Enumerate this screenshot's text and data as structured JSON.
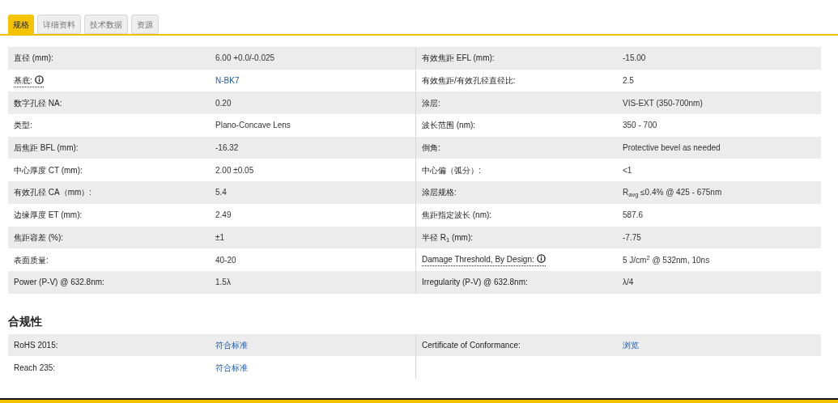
{
  "tabs": [
    {
      "label": "规格",
      "selected": true
    },
    {
      "label": "详细资料",
      "selected": false
    },
    {
      "label": "技术数据",
      "selected": false
    },
    {
      "label": "资源",
      "selected": false
    }
  ],
  "specs": {
    "rows": [
      [
        {
          "label": "直径 (mm):",
          "value": "6.00 +0.0/-0.025"
        },
        {
          "label": "有效焦距 EFL (mm):",
          "value": "-15.00"
        }
      ],
      [
        {
          "label": "基底:",
          "info": true,
          "value": "N-BK7",
          "link": true
        },
        {
          "label": "有效焦距/有效孔径直径比:",
          "value": "2.5"
        }
      ],
      [
        {
          "label": "数字孔径 NA:",
          "value": "0.20"
        },
        {
          "label": "涂层:",
          "value": "VIS-EXT (350-700nm)"
        }
      ],
      [
        {
          "label": "类型:",
          "value": "Plano-Concave Lens"
        },
        {
          "label": "波长范围 (nm):",
          "value": "350 - 700"
        }
      ],
      [
        {
          "label": "后焦距 BFL (mm):",
          "value": "-16.32"
        },
        {
          "label": "倒角:",
          "value": "Protective bevel as needed"
        }
      ],
      [
        {
          "label": "中心厚度 CT (mm):",
          "value": "2.00 ±0.05"
        },
        {
          "label": "中心偏（弧分）:",
          "value": "<1"
        }
      ],
      [
        {
          "label": "有效孔径 CA（mm）:",
          "value": "5.4"
        },
        {
          "label": "涂层规格:",
          "value": "R$_{avg}$ ≤0.4% @ 425 - 675nm"
        }
      ],
      [
        {
          "label": "边缘厚度 ET (mm):",
          "value": "2.49"
        },
        {
          "label": "焦距指定波长 (nm):",
          "value": "587.6"
        }
      ],
      [
        {
          "label": "焦距容差 (%):",
          "value": "±1"
        },
        {
          "label": "半径 R$_{1}$ (mm):",
          "value": "-7.75"
        }
      ],
      [
        {
          "label": "表面质量:",
          "value": "40-20"
        },
        {
          "label": "Damage Threshold, By Design:",
          "info": true,
          "value": "5 J/cm$^{2}$ @ 532nm, 10ns"
        }
      ],
      [
        {
          "label": "Power (P-V) @ 632.8nm:",
          "value": "1.5λ"
        },
        {
          "label": "Irregularity (P-V) @ 632.8nm:",
          "value": "λ/4"
        }
      ]
    ]
  },
  "compliance": {
    "title": "合规性",
    "rows": [
      [
        {
          "label": "RoHS 2015:",
          "value": "符合标准",
          "link": true
        },
        {
          "label": "Certificate of Conformance:",
          "value": "浏览",
          "link": true
        }
      ],
      [
        {
          "label": "Reach 235:",
          "value": "符合标准",
          "link": true
        }
      ]
    ]
  }
}
